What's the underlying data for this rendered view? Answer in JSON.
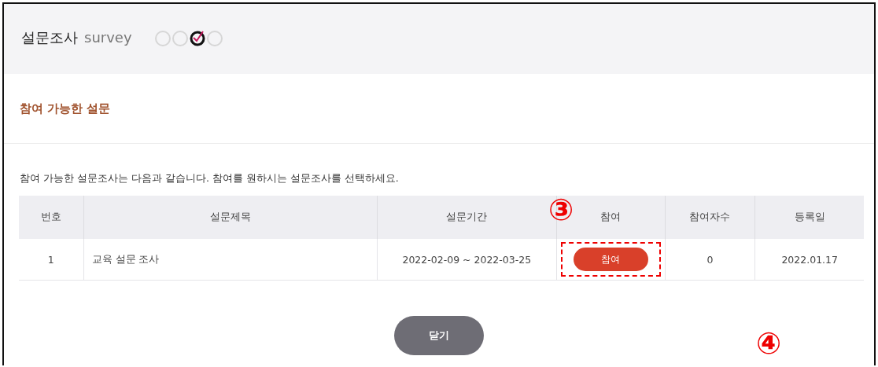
{
  "header": {
    "title": "설문조사",
    "subtitle": "survey",
    "steps": [
      {
        "selected": false
      },
      {
        "selected": false
      },
      {
        "selected": true
      },
      {
        "selected": false
      }
    ]
  },
  "section_title": "참여 가능한 설문",
  "description": "참여 가능한 설문조사는 다음과 같습니다. 참여를 원하시는 설문조사를 선택하세요.",
  "table": {
    "columns": [
      "번호",
      "설문제목",
      "설문기간",
      "참여",
      "참여자수",
      "등록일"
    ],
    "rows": [
      {
        "cells": [
          "1",
          "교육 설문 조사",
          "2022-02-09 ~ 2022-03-25",
          "참여",
          "0",
          "2022.01.17"
        ]
      }
    ]
  },
  "close_button": "닫기",
  "annotations": [
    {
      "label": "③"
    },
    {
      "label": "④"
    }
  ]
}
